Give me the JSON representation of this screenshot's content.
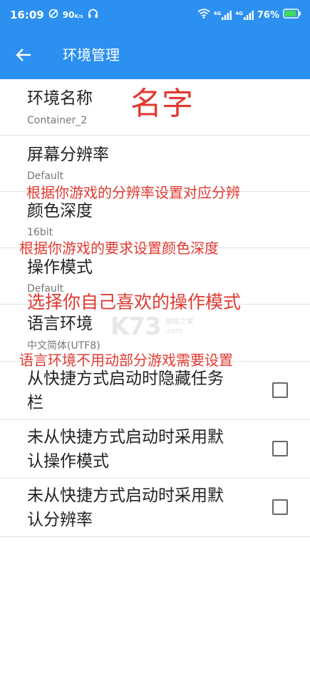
{
  "status_bar": {
    "time": "16:09",
    "speed": "90",
    "speed_unit": "K/s",
    "net1": "4G",
    "net2": "4G",
    "battery": "76%"
  },
  "app_bar": {
    "title": "环境管理"
  },
  "settings": [
    {
      "title": "环境名称",
      "value": "Container_2"
    },
    {
      "title": "屏幕分辨率",
      "value": "Default"
    },
    {
      "title": "颜色深度",
      "value": "16bit"
    },
    {
      "title": "操作模式",
      "value": "Default"
    },
    {
      "title": "语言环境",
      "value": "中文简体(UTF8)"
    }
  ],
  "checkboxes": [
    {
      "line1": "从快捷方式启动时隐藏任务",
      "line2": "栏",
      "checked": false
    },
    {
      "line1": "未从快捷方式启动时采用默",
      "line2": "认操作模式",
      "checked": false
    },
    {
      "line1": "未从快捷方式启动时采用默",
      "line2": "认分辨率",
      "checked": false
    }
  ],
  "annotations": {
    "name": "名字",
    "resolution": "根据你游戏的分辨率设置对应分辨",
    "color_depth": "根据你游戏的要求设置颜色深度",
    "operation_mode": "选择你自己喜欢的操作模式",
    "language": "语言环境不用动部分游戏需要设置"
  },
  "watermark": {
    "logo": "K73",
    "line1": "游戏之家",
    "line2": ".com"
  },
  "colors": {
    "primary": "#2b90f0",
    "annotation": "#e03a32"
  }
}
